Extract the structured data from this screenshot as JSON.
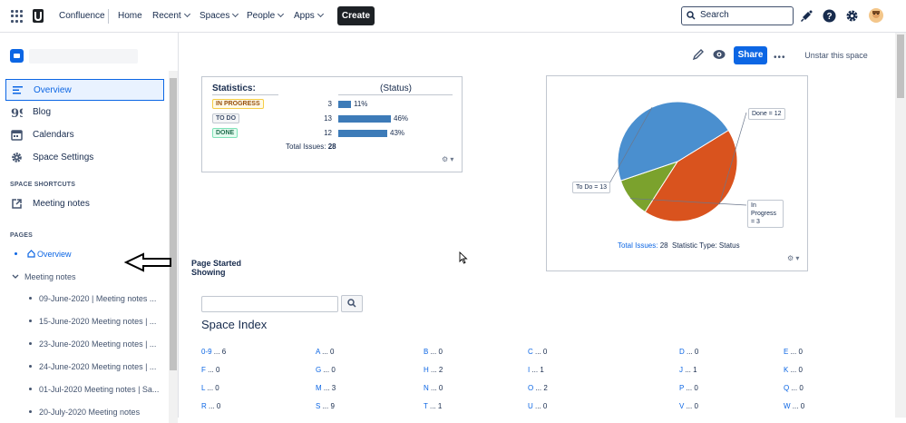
{
  "topbar": {
    "app_name": "Confluence",
    "nav": [
      {
        "label": "Home",
        "has_chevron": false
      },
      {
        "label": "Recent",
        "has_chevron": true
      },
      {
        "label": "Spaces",
        "has_chevron": true
      },
      {
        "label": "People",
        "has_chevron": true
      },
      {
        "label": "Apps",
        "has_chevron": true
      }
    ],
    "create_label": "Create",
    "search_placeholder": "Search",
    "icons": [
      "app-switcher-icon",
      "notifications-icon",
      "help-icon",
      "settings-icon",
      "avatar"
    ]
  },
  "sidebar": {
    "items": [
      {
        "label": "Overview",
        "icon": "overview-icon",
        "active": true
      },
      {
        "label": "Blog",
        "icon": "quote-icon",
        "active": false
      },
      {
        "label": "Calendars",
        "icon": "calendar-icon",
        "active": false
      },
      {
        "label": "Space Settings",
        "icon": "gear-icon",
        "active": false
      }
    ],
    "shortcuts_heading": "SPACE SHORTCUTS",
    "shortcuts": [
      {
        "label": "Meeting notes",
        "icon": "external-link-icon"
      }
    ],
    "pages_heading": "PAGES",
    "tree_overview": "Overview",
    "tree_meeting_notes": "Meeting notes",
    "tree_children": [
      "09-June-2020 | Meeting notes ...",
      "15-June-2020 Meeting notes | ...",
      "23-June-2020 Meeting notes | ...",
      "24-June-2020 Meeting notes | ...",
      "01-Jul-2020 Meeting notes | Sa...",
      "20-July-2020 Meeting notes"
    ]
  },
  "toolbar": {
    "share_label": "Share",
    "more_label": "•••",
    "unstar_label": "Unstar this space"
  },
  "stats": {
    "title": "Statistics:",
    "status_header": "(Status)",
    "rows": [
      {
        "status": "IN PROGRESS",
        "count": "3",
        "percent": "11%",
        "fraction": 0.11,
        "color": "#974f0c",
        "bg": "#fffae6",
        "border": "#f5cd47"
      },
      {
        "status": "TO DO",
        "count": "13",
        "percent": "46%",
        "fraction": 0.46,
        "color": "#42526e",
        "bg": "#f4f5f7",
        "border": "#c1c7d0"
      },
      {
        "status": "DONE",
        "count": "12",
        "percent": "43%",
        "fraction": 0.43,
        "color": "#216e4e",
        "bg": "#e3fcef",
        "border": "#7ee2b8"
      }
    ],
    "total_label": "Total Issues:",
    "total_value": "28",
    "gear": "⚙ ▾"
  },
  "chart_data": {
    "type": "pie",
    "slices": [
      {
        "label": "Done = 12",
        "value": 12,
        "color": "#d9531e"
      },
      {
        "label": "In Progress = 3",
        "value": 3,
        "color": "#7ba22d"
      },
      {
        "label": "To Do = 13",
        "value": 13,
        "color": "#4a8fcf"
      }
    ],
    "total_label": "Total Issues:",
    "total_value": "28",
    "type_label": "Statistic Type:",
    "type_value": "Status",
    "gear": "⚙ ▾"
  },
  "page_started": {
    "line1": "Page Started",
    "line2": "Showing"
  },
  "space_index": {
    "title": "Space Index",
    "entries": [
      [
        "0-9",
        "6"
      ],
      [
        "A",
        "0"
      ],
      [
        "B",
        "0"
      ],
      [
        "C",
        "0"
      ],
      [
        "D",
        "0"
      ],
      [
        "E",
        "0"
      ],
      [
        "F",
        "0"
      ],
      [
        "G",
        "0"
      ],
      [
        "H",
        "2"
      ],
      [
        "I",
        "1"
      ],
      [
        "J",
        "1"
      ],
      [
        "K",
        "0"
      ],
      [
        "L",
        "0"
      ],
      [
        "M",
        "3"
      ],
      [
        "N",
        "0"
      ],
      [
        "O",
        "2"
      ],
      [
        "P",
        "0"
      ],
      [
        "Q",
        "0"
      ],
      [
        "R",
        "0"
      ],
      [
        "S",
        "9"
      ],
      [
        "T",
        "1"
      ],
      [
        "U",
        "0"
      ],
      [
        "V",
        "0"
      ],
      [
        "W",
        "0"
      ]
    ]
  }
}
